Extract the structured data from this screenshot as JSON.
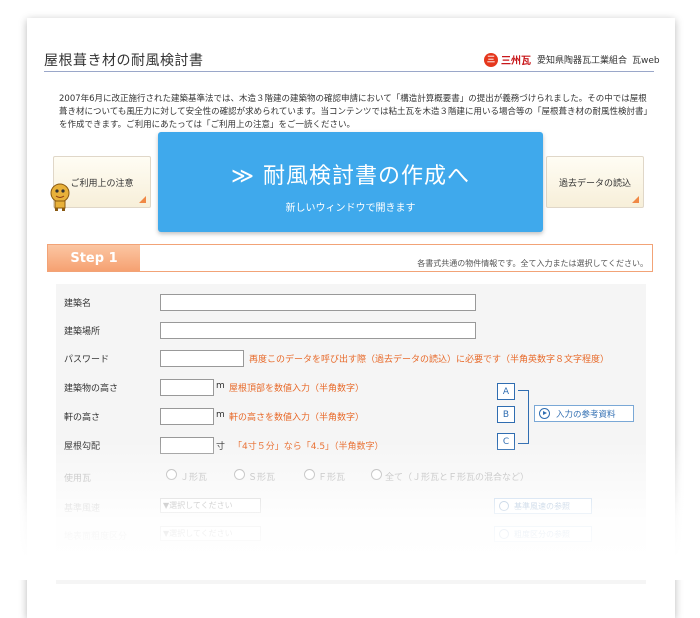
{
  "header": {
    "title": "屋根葺き材の耐風検討書",
    "logo_mark": "三",
    "logo_name": "三州瓦",
    "logo_org": "愛知県陶器瓦工業組合",
    "logo_web": "瓦web"
  },
  "intro": "2007年6月に改正施行された建築基準法では、木造３階建の建築物の確認申請において「構造計算概要書」の提出が義務づけられました。その中では屋根葺き材についても風圧力に対して安全性の確認が求められています。当コンテンツでは粘土瓦を木造３階建に用いる場合等の「屋根葺き材の耐風性検討書」を作成できます。ご利用にあたっては「ご利用上の注意」をご一読ください。",
  "buttons": {
    "notice": "ご利用上の注意",
    "create_main": "≫ 耐風検討書の作成へ",
    "create_sub": "新しいウィンドウで開きます",
    "load_past": "過去データの読込"
  },
  "step": {
    "label": "Step 1",
    "note": "各書式共通の物件情報です。全て入力または選択してください。"
  },
  "form": {
    "building_name": {
      "label": "建築名",
      "value": ""
    },
    "building_site": {
      "label": "建築場所",
      "value": ""
    },
    "password": {
      "label": "パスワード",
      "value": "",
      "hint": "再度このデータを呼び出す際（過去データの読込）に必要です（半角英数字８文字程度）"
    },
    "building_height": {
      "label": "建築物の高さ",
      "value": "",
      "unit": "m",
      "hint": "屋根頂部を数値入力（半角数字）"
    },
    "eave_height": {
      "label": "軒の高さ",
      "value": "",
      "unit": "m",
      "hint": "軒の高さを数値入力（半角数字）"
    },
    "roof_pitch": {
      "label": "屋根勾配",
      "value": "",
      "unit": "寸",
      "hint": "「4寸５分」なら「4.5」（半角数字）"
    },
    "tile_type": {
      "label": "使用瓦",
      "options": [
        "Ｊ形瓦",
        "Ｓ形瓦",
        "Ｆ形瓦",
        "全て（Ｊ形瓦とＦ形瓦の混合など）"
      ]
    },
    "base_wind_speed": {
      "label": "基準風速",
      "select": "▼選択してください"
    },
    "roughness": {
      "label": "地表面粗度区分",
      "select": "▼選択してください"
    }
  },
  "diagram_refs": {
    "a": "A",
    "b": "B",
    "c": "C",
    "ref_button": "入力の参考資料"
  },
  "side_buttons": {
    "wind_speed_ref": "基準風速の参照",
    "roughness_ref": "粗度区分の参照"
  },
  "colors": {
    "accent_blue": "#3fa9ec",
    "step_orange": "#f6a171",
    "hint_orange": "#e86a2a",
    "logo_red": "#c8171a"
  }
}
